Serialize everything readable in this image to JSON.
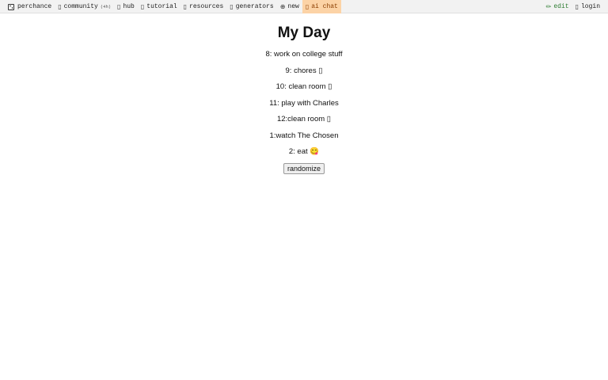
{
  "nav": {
    "left": [
      {
        "icon": "dice-icon",
        "label": "perchance",
        "sub": ""
      },
      {
        "icon": "chat-bubble-icon",
        "glyph": "▯",
        "label": "community",
        "sub": "(4h)"
      },
      {
        "icon": "hub-icon",
        "glyph": "▯",
        "label": "hub",
        "sub": ""
      },
      {
        "icon": "book-icon",
        "glyph": "▯",
        "label": "tutorial",
        "sub": ""
      },
      {
        "icon": "folder-icon",
        "glyph": "▯",
        "label": "resources",
        "sub": ""
      },
      {
        "icon": "cogs-icon",
        "glyph": "▯",
        "label": "generators",
        "sub": ""
      },
      {
        "icon": "plus-circle-icon",
        "glyph": "⊕",
        "label": "new",
        "sub": ""
      },
      {
        "icon": "robot-icon",
        "glyph": "▯",
        "label": "ai chat",
        "sub": ""
      }
    ],
    "right": [
      {
        "icon": "pencil-icon",
        "glyph": "✏",
        "label": "edit"
      },
      {
        "icon": "user-icon",
        "glyph": "▯",
        "label": "login"
      }
    ],
    "highlight_color": "#fcd3a6"
  },
  "page": {
    "title": "My Day",
    "lines": [
      "8: work on college stuff",
      "9: chores ▯",
      "10: clean room ▯",
      "11: play with Charles",
      "12:clean room ▯",
      "1:watch The Chosen",
      "2: eat 😋"
    ],
    "button_label": "randomize"
  }
}
